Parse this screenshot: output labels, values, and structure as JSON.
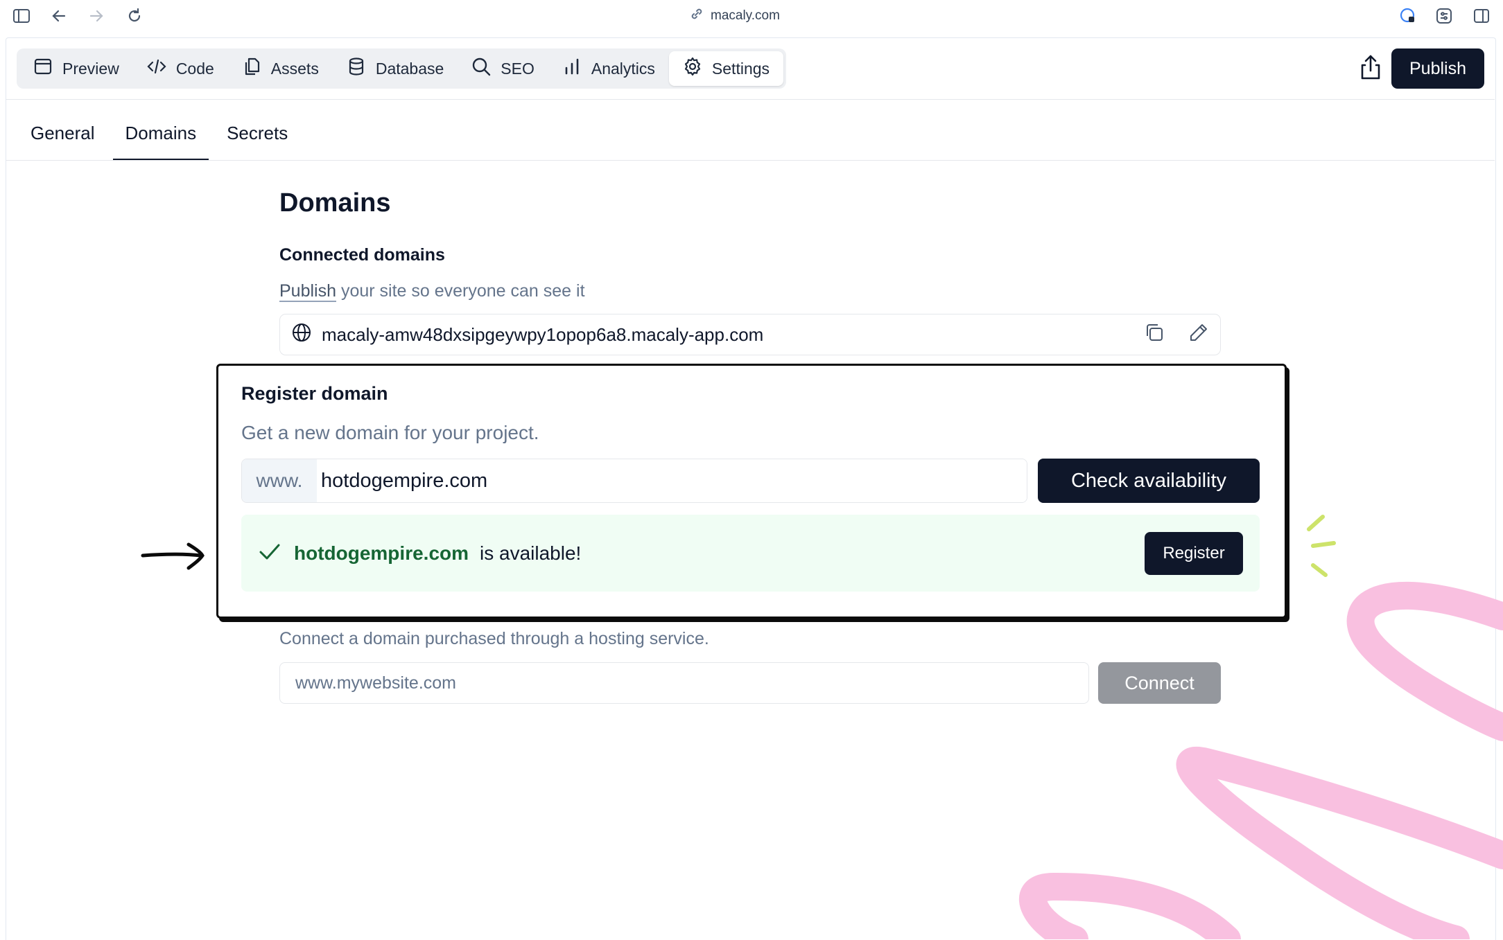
{
  "browser": {
    "url": "macaly.com",
    "icons": [
      "sidebar-toggle-icon",
      "back-arrow-icon",
      "forward-arrow-icon",
      "reload-icon",
      "link-icon",
      "extension-icon",
      "settings-sliders-icon",
      "split-view-icon"
    ]
  },
  "toolbar": {
    "items": [
      {
        "label": "Preview",
        "icon": "preview-window-icon",
        "active": false
      },
      {
        "label": "Code",
        "icon": "code-icon",
        "active": false
      },
      {
        "label": "Assets",
        "icon": "assets-files-icon",
        "active": false
      },
      {
        "label": "Database",
        "icon": "database-icon",
        "active": false
      },
      {
        "label": "SEO",
        "icon": "search-icon",
        "active": false
      },
      {
        "label": "Analytics",
        "icon": "bar-chart-icon",
        "active": false
      },
      {
        "label": "Settings",
        "icon": "gear-icon",
        "active": true
      }
    ],
    "publish_label": "Publish"
  },
  "tabs": [
    {
      "label": "General",
      "active": false
    },
    {
      "label": "Domains",
      "active": true
    },
    {
      "label": "Secrets",
      "active": false
    }
  ],
  "main": {
    "title": "Domains",
    "connected_heading": "Connected domains",
    "publish_link": "Publish",
    "publish_desc_rest": " your site so everyone can see it",
    "connected_domain": "macaly-amw48dxsipgeywpy1opop6a8.macaly-app.com"
  },
  "register": {
    "title": "Register domain",
    "description": "Get a new domain for your project.",
    "prefix": "www.",
    "input_value": "hotdogempire.com",
    "check_label": "Check availability",
    "result_domain": "hotdogempire.com",
    "result_text": "is available!",
    "register_label": "Register"
  },
  "connect": {
    "description": "Connect a domain purchased through a hosting service.",
    "placeholder": "www.mywebsite.com",
    "button_label": "Connect"
  },
  "colors": {
    "primary": "#0f172a",
    "success_bg": "#f0fdf4",
    "success_text": "#166534",
    "muted_text": "#64748b",
    "decor_pink": "#f9c0e0",
    "decor_green": "#cde36a"
  }
}
